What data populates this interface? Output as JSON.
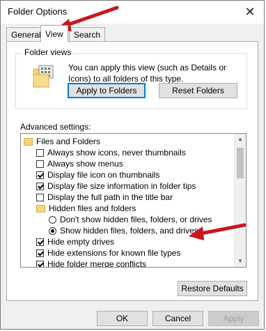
{
  "window": {
    "title": "Folder Options",
    "close_glyph": "✕"
  },
  "tabs": [
    {
      "label": "General",
      "active": false
    },
    {
      "label": "View",
      "active": true
    },
    {
      "label": "Search",
      "active": false
    }
  ],
  "folder_views": {
    "legend": "Folder views",
    "description": "You can apply this view (such as Details or Icons) to all folders of this type.",
    "apply_button": "Apply to Folders",
    "reset_button": "Reset Folders"
  },
  "advanced": {
    "label": "Advanced settings:",
    "items": [
      {
        "type": "folder",
        "label": "Files and Folders"
      },
      {
        "type": "checkbox",
        "checked": false,
        "label": "Always show icons, never thumbnails"
      },
      {
        "type": "checkbox",
        "checked": false,
        "label": "Always show menus"
      },
      {
        "type": "checkbox",
        "checked": true,
        "label": "Display file icon on thumbnails"
      },
      {
        "type": "checkbox",
        "checked": true,
        "label": "Display file size information in folder tips"
      },
      {
        "type": "checkbox",
        "checked": false,
        "label": "Display the full path in the title bar"
      },
      {
        "type": "folder",
        "label": "Hidden files and folders"
      },
      {
        "type": "radio",
        "checked": false,
        "label": "Don't show hidden files, folders, or drives"
      },
      {
        "type": "radio",
        "checked": true,
        "label": "Show hidden files, folders, and drives"
      },
      {
        "type": "checkbox",
        "checked": true,
        "label": "Hide empty drives"
      },
      {
        "type": "checkbox",
        "checked": true,
        "label": "Hide extensions for known file types"
      },
      {
        "type": "checkbox",
        "checked": true,
        "label": "Hide folder merge conflicts"
      }
    ],
    "scroll_up": "▲",
    "scroll_down": "▼"
  },
  "restore_button": "Restore Defaults",
  "footer": {
    "ok": "OK",
    "cancel": "Cancel",
    "apply": "Apply"
  },
  "colors": {
    "accent": "#0078d7",
    "annotation_arrow": "#c8161d"
  }
}
